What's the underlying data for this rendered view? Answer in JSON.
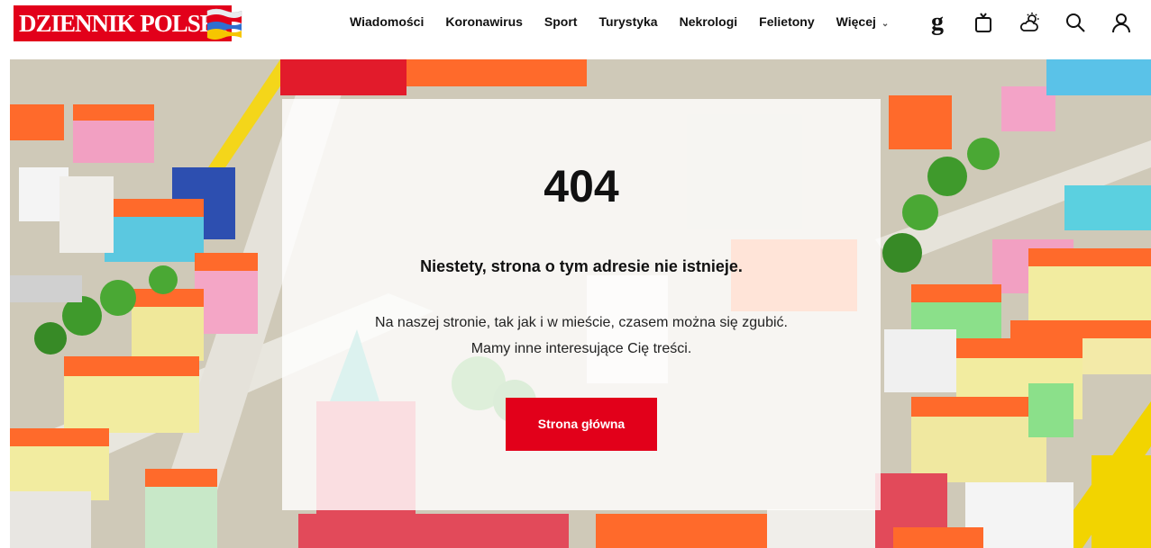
{
  "header": {
    "logo_text": "DZIENNIK POLSKI",
    "nav": [
      {
        "label": "Wiadomości"
      },
      {
        "label": "Koronawirus"
      },
      {
        "label": "Sport"
      },
      {
        "label": "Turystyka"
      },
      {
        "label": "Nekrologi"
      },
      {
        "label": "Felietony"
      },
      {
        "label": "Więcej"
      }
    ],
    "icons": [
      "gazeta-g-icon",
      "tv-icon",
      "weather-icon",
      "search-icon",
      "user-icon"
    ]
  },
  "error": {
    "code": "404",
    "headline": "Niestety, strona o tym adresie nie istnieje.",
    "message_line1": "Na naszej stronie, tak jak i w mieście, czasem można się zgubić.",
    "message_line2": "Mamy inne interesujące Cię treści.",
    "button_label": "Strona główna"
  },
  "colors": {
    "brand_red": "#e2001a"
  }
}
